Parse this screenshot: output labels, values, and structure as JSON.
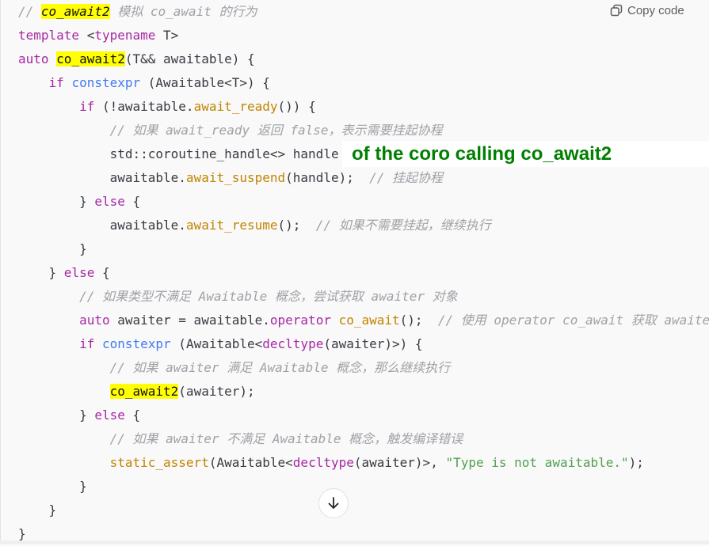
{
  "toolbar": {
    "copy_label": "Copy code",
    "copy_icon": "copy-icon"
  },
  "annotation": "of the coro calling co_await2",
  "scroll_icon": "arrow-down-icon",
  "code_lines": [
    [
      [
        "cm",
        "// "
      ],
      [
        "hlc",
        "co_await2"
      ],
      [
        "cm",
        " 模拟 co_await 的行为"
      ]
    ],
    [
      [
        "kw",
        "template"
      ],
      [
        "pl",
        " <"
      ],
      [
        "kw",
        "typename"
      ],
      [
        "pl",
        " T>"
      ]
    ],
    [
      [
        "kw",
        "auto"
      ],
      [
        "pl",
        " "
      ],
      [
        "hl",
        "co_await2"
      ],
      [
        "pl",
        "(T&& awaitable) {"
      ]
    ],
    [
      [
        "pl",
        "    "
      ],
      [
        "kw",
        "if"
      ],
      [
        "pl",
        " "
      ],
      [
        "bl",
        "constexpr"
      ],
      [
        "pl",
        " (Awaitable<T>) {"
      ]
    ],
    [
      [
        "pl",
        "        "
      ],
      [
        "kw",
        "if"
      ],
      [
        "pl",
        " (!awaitable."
      ],
      [
        "fn",
        "await_ready"
      ],
      [
        "pl",
        "()) {"
      ]
    ],
    [
      [
        "pl",
        "            "
      ],
      [
        "cm",
        "// 如果 await_ready 返回 false，表示需要挂起协程"
      ]
    ],
    [
      [
        "pl",
        "            std::coroutine_handle<> handle"
      ]
    ],
    [
      [
        "pl",
        "            awaitable."
      ],
      [
        "fn",
        "await_suspend"
      ],
      [
        "pl",
        "(handle);  "
      ],
      [
        "cm",
        "// 挂起协程"
      ]
    ],
    [
      [
        "pl",
        "        } "
      ],
      [
        "kw",
        "else"
      ],
      [
        "pl",
        " {"
      ]
    ],
    [
      [
        "pl",
        "            awaitable."
      ],
      [
        "fn",
        "await_resume"
      ],
      [
        "pl",
        "();  "
      ],
      [
        "cm",
        "// 如果不需要挂起，继续执行"
      ]
    ],
    [
      [
        "pl",
        "        }"
      ]
    ],
    [
      [
        "pl",
        "    } "
      ],
      [
        "kw",
        "else"
      ],
      [
        "pl",
        " {"
      ]
    ],
    [
      [
        "pl",
        "        "
      ],
      [
        "cm",
        "// 如果类型不满足 Awaitable 概念，尝试获取 awaiter 对象"
      ]
    ],
    [
      [
        "pl",
        "        "
      ],
      [
        "kw",
        "auto"
      ],
      [
        "pl",
        " awaiter = awaitable."
      ],
      [
        "kw",
        "operator"
      ],
      [
        "pl",
        " "
      ],
      [
        "fn",
        "co_await"
      ],
      [
        "pl",
        "();  "
      ],
      [
        "cm",
        "// 使用 operator co_await 获取 awaiter"
      ]
    ],
    [
      [
        "pl",
        "        "
      ],
      [
        "kw",
        "if"
      ],
      [
        "pl",
        " "
      ],
      [
        "bl",
        "constexpr"
      ],
      [
        "pl",
        " (Awaitable<"
      ],
      [
        "kw",
        "decltype"
      ],
      [
        "pl",
        "(awaiter)>) {"
      ]
    ],
    [
      [
        "pl",
        "            "
      ],
      [
        "cm",
        "// 如果 awaiter 满足 Awaitable 概念，那么继续执行"
      ]
    ],
    [
      [
        "pl",
        "            "
      ],
      [
        "hl",
        "co_await2"
      ],
      [
        "pl",
        "(awaiter);"
      ]
    ],
    [
      [
        "pl",
        "        } "
      ],
      [
        "kw",
        "else"
      ],
      [
        "pl",
        " {"
      ]
    ],
    [
      [
        "pl",
        "            "
      ],
      [
        "cm",
        "// 如果 awaiter 不满足 Awaitable 概念，触发编译错误"
      ]
    ],
    [
      [
        "pl",
        "            "
      ],
      [
        "fn",
        "static_assert"
      ],
      [
        "pl",
        "(Awaitable<"
      ],
      [
        "kw",
        "decltype"
      ],
      [
        "pl",
        "(awaiter)>, "
      ],
      [
        "st",
        "\"Type is not awaitable.\""
      ],
      [
        "pl",
        ");"
      ]
    ],
    [
      [
        "pl",
        "        }"
      ]
    ],
    [
      [
        "pl",
        "    }"
      ]
    ],
    [
      [
        "pl",
        "}"
      ]
    ]
  ]
}
